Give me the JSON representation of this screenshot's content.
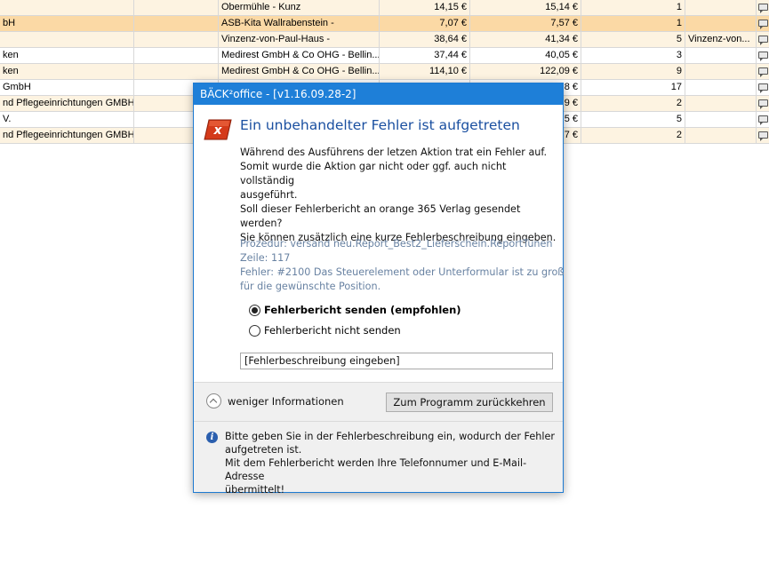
{
  "table": {
    "rows": [
      {
        "name": "",
        "customer": "Obermühle - Kunz",
        "v1": "14,15 €",
        "v2": "15,14 €",
        "qty": "1",
        "note": ""
      },
      {
        "name": "bH",
        "customer": "ASB-Kita Wallrabenstein -",
        "v1": "7,07 €",
        "v2": "7,57 €",
        "qty": "1",
        "note": ""
      },
      {
        "name": "",
        "customer": "Vinzenz-von-Paul-Haus -",
        "v1": "38,64 €",
        "v2": "41,34 €",
        "qty": "5",
        "note": "Vinzenz-von..."
      },
      {
        "name": "ken",
        "customer": "Medirest GmbH & Co OHG - Bellin...",
        "v1": "37,44 €",
        "v2": "40,05 €",
        "qty": "3",
        "note": ""
      },
      {
        "name": "ken",
        "customer": "Medirest GmbH & Co OHG - Bellin...",
        "v1": "114,10 €",
        "v2": "122,09 €",
        "qty": "9",
        "note": ""
      },
      {
        "name": "GmbH",
        "customer": "",
        "v1": "",
        "v2": "8 €",
        "qty": "17",
        "note": ""
      },
      {
        "name": "nd Pflegeeinrichtungen GMBH",
        "customer": "",
        "v1": "",
        "v2": "9 €",
        "qty": "2",
        "note": ""
      },
      {
        "name": "V.",
        "customer": "",
        "v1": "",
        "v2": "5 €",
        "qty": "5",
        "note": ""
      },
      {
        "name": "nd Pflegeeinrichtungen GMBH",
        "customer": "",
        "v1": "",
        "v2": "7 €",
        "qty": "2",
        "note": ""
      }
    ]
  },
  "dialog": {
    "title": "BÄCK²office - [v1.16.09.28-2]",
    "heading": "Ein unbehandelter Fehler ist aufgetreten",
    "paragraph1": "Während des Ausführens der letzen Aktion trat ein Fehler auf.\nSomit wurde die Aktion gar nicht oder ggf. auch nicht vollständig\nausgeführt.",
    "paragraph2": "Soll dieser Fehlerbericht an orange 365 Verlag gesendet werden?\nSie können zusätzlich eine kurze Fehlerbeschreibung eingeben.",
    "details": {
      "procedure": "Prozedur: versand neu.Report_Best2_Lieferschein.ReportTunen",
      "line": "Zeile: 117",
      "error1": "Fehler: #2100 Das Steuerelement oder Unterformular ist zu groß",
      "error2": "für die gewünschte Position."
    },
    "option_send": "Fehlerbericht senden (empfohlen)",
    "option_no_send": "Fehlerbericht nicht senden",
    "description_value": "[Fehlerbeschreibung eingeben]",
    "less_info": "weniger Informationen",
    "return_button": "Zum Programm zurückkehren",
    "info_text": "Bitte geben Sie in der Fehlerbeschreibung ein, wodurch der Fehler\naufgetreten ist.\nMit dem Fehlerbericht werden Ihre Telefonnumer und E-Mail-Adresse\nübermittelt!"
  },
  "colors": {
    "titlebar": "#1e7fd8",
    "row_alt": "#fdf3e1",
    "row_selected": "#fbd9a5",
    "heading": "#1a4fa0",
    "details": "#6882a2"
  }
}
